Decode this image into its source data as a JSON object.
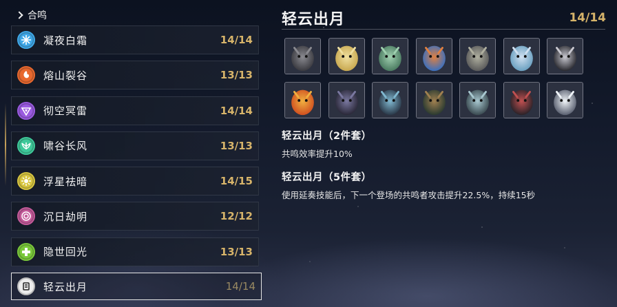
{
  "header": {
    "label": "合鸣"
  },
  "sonata_list": [
    {
      "name": "凝夜白霜",
      "count": "14/14",
      "icon": "snowflake-icon",
      "color": "#3fa8e8"
    },
    {
      "name": "熔山裂谷",
      "count": "13/13",
      "icon": "flame-swirl-icon",
      "color": "#e8682e"
    },
    {
      "name": "彻空冥雷",
      "count": "14/14",
      "icon": "thunder-chevron-icon",
      "color": "#9a5ae0"
    },
    {
      "name": "啸谷长风",
      "count": "13/13",
      "icon": "wind-wings-icon",
      "color": "#3ec99a"
    },
    {
      "name": "浮星祛暗",
      "count": "14/15",
      "icon": "star-sun-icon",
      "color": "#d8c640"
    },
    {
      "name": "沉日劫明",
      "count": "12/12",
      "icon": "vortex-icon",
      "color": "#c45a9a"
    },
    {
      "name": "隐世回光",
      "count": "13/13",
      "icon": "healing-cross-icon",
      "color": "#7ac83a"
    },
    {
      "name": "轻云出月",
      "count": "14/14",
      "icon": "cloud-moon-icon",
      "color": "#d8d8d8"
    }
  ],
  "detail": {
    "title": "轻云出月",
    "count": "14/14",
    "echoes": [
      {
        "icon": "echo-dark-beast-icon",
        "c1": "#3a3a40",
        "c2": "#8a8a90"
      },
      {
        "icon": "echo-golden-spirit-icon",
        "c1": "#c8a850",
        "c2": "#f0e0a0"
      },
      {
        "icon": "echo-green-serpent-icon",
        "c1": "#4a7a60",
        "c2": "#a0d0b0"
      },
      {
        "icon": "echo-blue-flower-icon",
        "c1": "#3a70c0",
        "c2": "#e08040"
      },
      {
        "icon": "echo-stone-golem-icon",
        "c1": "#5a5a5a",
        "c2": "#b0b0a0"
      },
      {
        "icon": "echo-dragonfly-icon",
        "c1": "#6aa0c0",
        "c2": "#d0e0f0"
      },
      {
        "icon": "echo-horned-knight-icon",
        "c1": "#2a2a30",
        "c2": "#c8c8d0"
      },
      {
        "icon": "echo-fire-lion-icon",
        "c1": "#d05020",
        "c2": "#f0b040"
      },
      {
        "icon": "echo-shadow-wolf-icon",
        "c1": "#2a2838",
        "c2": "#7a78a0"
      },
      {
        "icon": "echo-frost-beast-icon",
        "c1": "#2a3848",
        "c2": "#80b8d0"
      },
      {
        "icon": "echo-thorn-crab-icon",
        "c1": "#2a3a30",
        "c2": "#a08050"
      },
      {
        "icon": "echo-ice-dragon-icon",
        "c1": "#3a4a50",
        "c2": "#a8c8d0"
      },
      {
        "icon": "echo-crimson-serpent-icon",
        "c1": "#2a2228",
        "c2": "#c05050"
      },
      {
        "icon": "echo-white-wolf-icon",
        "c1": "#5a6070",
        "c2": "#f0f4f8"
      }
    ],
    "set_bonuses": [
      {
        "title": "轻云出月（2件套）",
        "desc": "共鸣效率提升10%"
      },
      {
        "title": "轻云出月（5件套）",
        "desc": "使用延奏技能后，下一个登场的共鸣者攻击提升22.5%，持续15秒"
      }
    ]
  }
}
